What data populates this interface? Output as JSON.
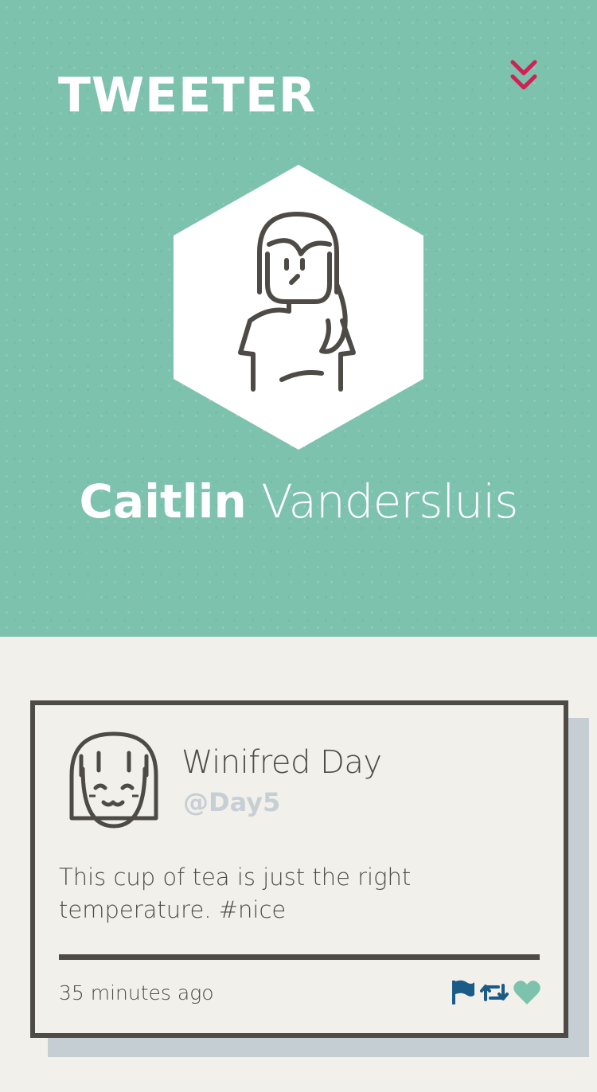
{
  "header": {
    "logo_text": "TWEETER",
    "menu_icon": "double-chevron-down-icon",
    "accent_color": "#cf2154"
  },
  "profile": {
    "first_name": "Caitlin",
    "last_name": "Vandersluis",
    "background_color": "#7cc2ad"
  },
  "tweet": {
    "author_name": "Winifred Day",
    "handle": "@Day5",
    "text": "This cup of tea is just the right temperature. #nice",
    "timestamp": "35 minutes ago",
    "actions": [
      {
        "name": "flag",
        "icon": "flag-icon",
        "color": "#1a5c87"
      },
      {
        "name": "retweet",
        "icon": "retweet-icon",
        "color": "#1a5c87"
      },
      {
        "name": "like",
        "icon": "heart-icon",
        "color": "#7cc2ad"
      }
    ]
  }
}
